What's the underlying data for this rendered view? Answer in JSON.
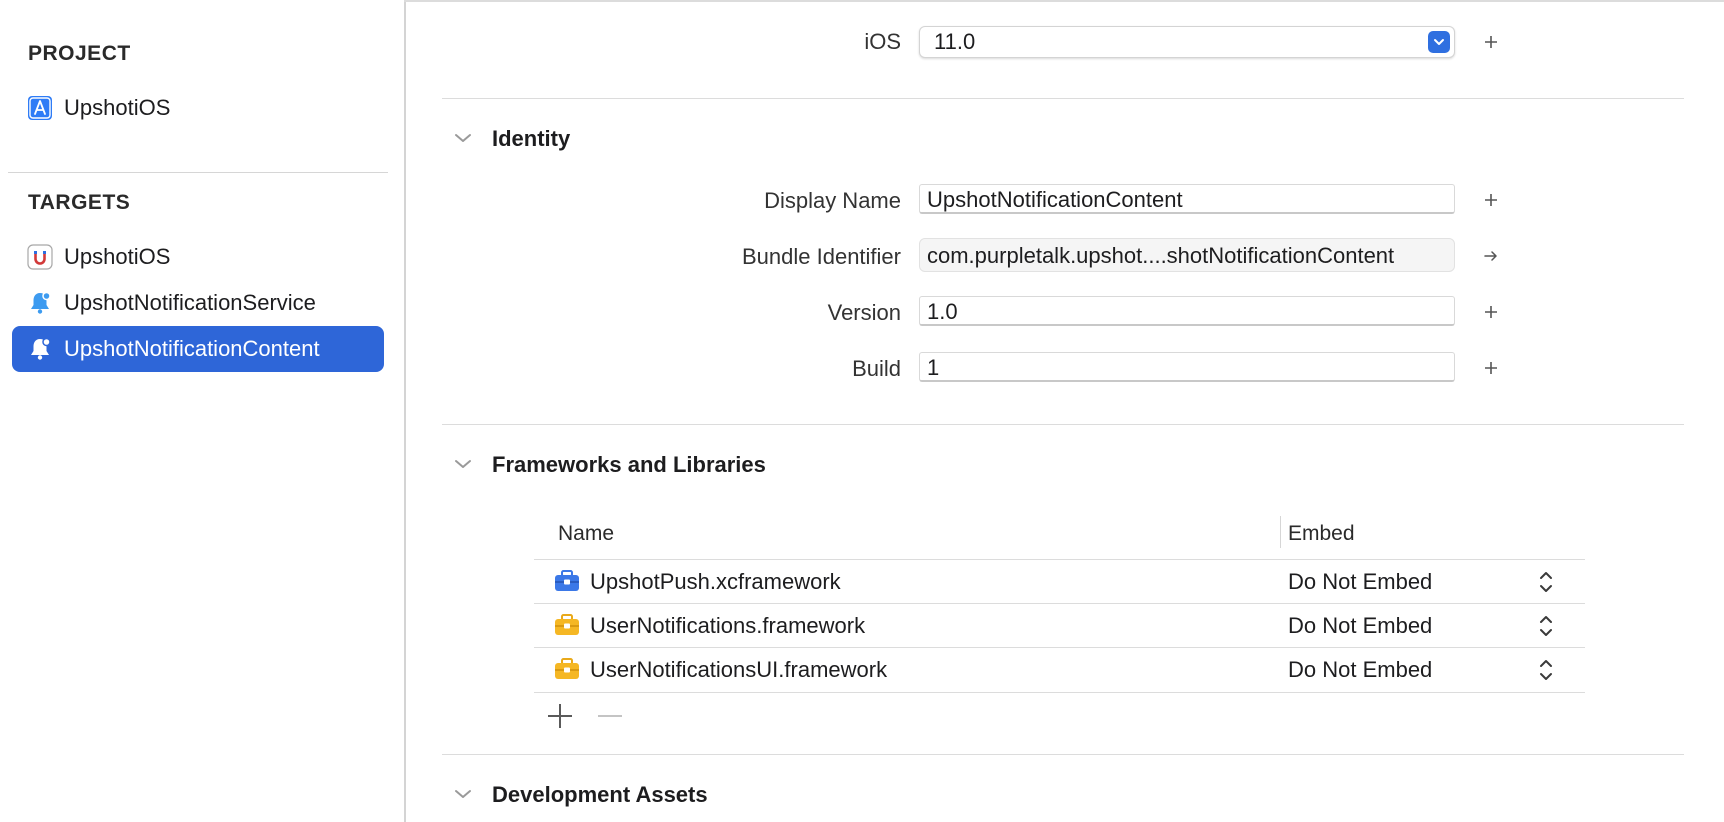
{
  "sidebar": {
    "project_header": "PROJECT",
    "project_item": "UpshotiOS",
    "targets_header": "TARGETS",
    "targets": [
      {
        "label": "UpshotiOS",
        "icon": "app-target-icon"
      },
      {
        "label": "UpshotNotificationService",
        "icon": "notification-extension-icon"
      },
      {
        "label": "UpshotNotificationContent",
        "icon": "notification-extension-icon",
        "selected": true
      }
    ]
  },
  "deployment": {
    "ios_label": "iOS",
    "ios_value": "11.0"
  },
  "identity": {
    "title": "Identity",
    "display_name_label": "Display Name",
    "display_name_value": "UpshotNotificationContent",
    "bundle_id_label": "Bundle Identifier",
    "bundle_id_value": "com.purpletalk.upshot....shotNotificationContent",
    "version_label": "Version",
    "version_value": "1.0",
    "build_label": "Build",
    "build_value": "1"
  },
  "frameworks": {
    "title": "Frameworks and Libraries",
    "col_name": "Name",
    "col_embed": "Embed",
    "rows": [
      {
        "name": "UpshotPush.xcframework",
        "embed": "Do Not Embed",
        "color": "#3b78e7"
      },
      {
        "name": "UserNotifications.framework",
        "embed": "Do Not Embed",
        "color": "#f5b724"
      },
      {
        "name": "UserNotificationsUI.framework",
        "embed": "Do Not Embed",
        "color": "#f5b724"
      }
    ]
  },
  "dev_assets": {
    "title": "Development Assets"
  },
  "colors": {
    "accent": "#2e66d8",
    "popup_arrow": "#2f6fe0"
  }
}
